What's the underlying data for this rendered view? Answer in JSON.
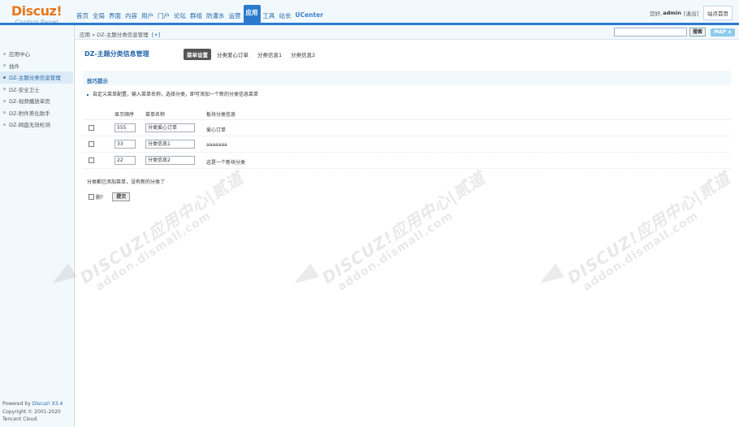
{
  "logo": {
    "main": "Discuz!",
    "sub": "Control Panel"
  },
  "topnav": [
    "首页",
    "全局",
    "界面",
    "内容",
    "用户",
    "门户",
    "论坛",
    "群组",
    "防灌水",
    "运营",
    "应用",
    "工具",
    "站长",
    "UCenter"
  ],
  "topnav_active": "应用",
  "user": {
    "greeting": "您好,",
    "name": "admin",
    "logout": "[退出]",
    "home": "站点首页"
  },
  "sidebar": {
    "items": [
      "应用中心",
      "插件",
      "DZ-主题分类信息管理",
      "DZ-安全卫士",
      "DZ-视频播放单页",
      "DZ-附件美化助手",
      "DZ-网盘无效检测"
    ],
    "active_index": 2
  },
  "footer": {
    "powered": "Powered by ",
    "brand": "Discuz! X3.4",
    "copyright": "Copyright © 2001-2020",
    "company": "Tencent Cloud."
  },
  "crumb": {
    "text": "应用 » DZ-主题分类信息管理",
    "add": "[+]"
  },
  "search": {
    "value": "",
    "button": "搜索",
    "map": "MAP ±"
  },
  "page": {
    "title": "DZ-主题分类信息管理",
    "tabs": [
      "菜单设置",
      "分类爱心订单",
      "分类信息1",
      "分类信息2"
    ],
    "current_tab": 0
  },
  "tips": {
    "title": "技巧提示",
    "line": "自定义菜单配置，输入菜单名称，选择分类，即可添加一个新的分类信息菜单"
  },
  "table": {
    "headers": [
      "显示顺序",
      "菜单名称",
      "板块分类信息"
    ],
    "rows": [
      {
        "order": "555",
        "name": "分类爱心订单",
        "info": "爱心订单"
      },
      {
        "order": "33",
        "name": "分类信息1",
        "info": "aaaaaaa"
      },
      {
        "order": "22",
        "name": "分类信息2",
        "info": "这是一个新块分类"
      }
    ]
  },
  "added_note": "分类都已添加菜单，没有新的分类了",
  "delete_label": "删?",
  "submit_label": "提交",
  "watermark": {
    "line1": "DISCUZ!应用中心|贰道",
    "line2": "addon.dismall.com"
  },
  "colors": {
    "accent": "#2b7acd",
    "logo": "#e8781c",
    "panel": "#f2f9fd"
  }
}
